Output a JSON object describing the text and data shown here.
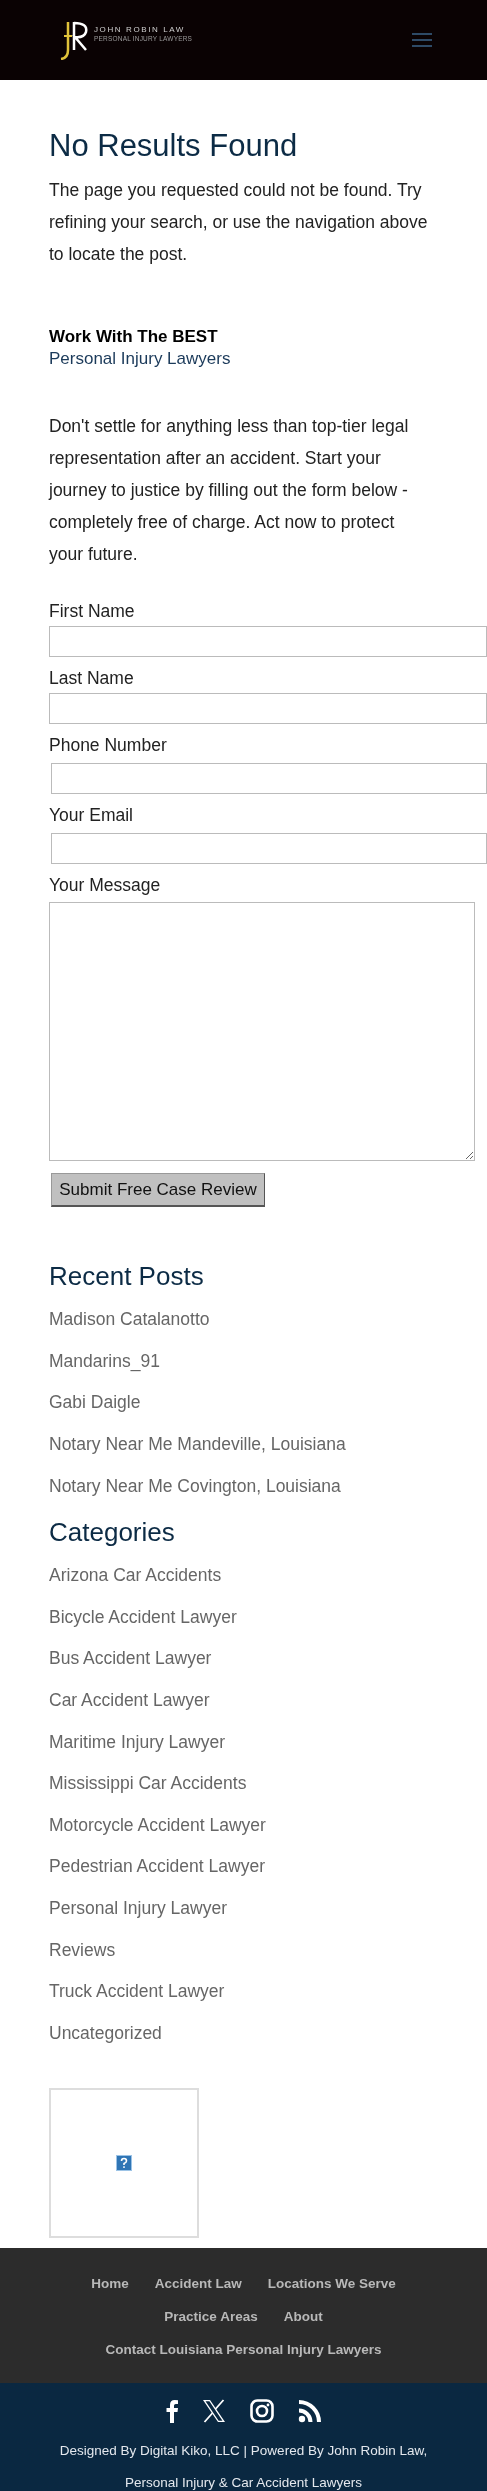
{
  "header": {
    "logo_name": "JOHN ROBIN LAW",
    "logo_tagline": "PERSONAL INJURY LAWYERS"
  },
  "main": {
    "title": "No Results Found",
    "message": "The page you requested could not be found. Try refining your search, or use the navigation above to locate the post."
  },
  "promo": {
    "heading": "Work With The BEST",
    "subheading": "Personal Injury Lawyers",
    "text": "Don't settle for anything less than top-tier legal representation after an accident. Start your journey to justice by filling out the form below - completely free of charge. Act now to protect your future."
  },
  "form": {
    "fields": [
      {
        "label": "First Name",
        "kind": "text"
      },
      {
        "label": "Last Name",
        "kind": "text"
      },
      {
        "label": "Phone Number",
        "kind": "text"
      },
      {
        "label": "Your Email",
        "kind": "text"
      },
      {
        "label": "Your Message",
        "kind": "textarea"
      }
    ],
    "submit": "Submit Free Case Review"
  },
  "recent_posts": {
    "heading": "Recent Posts",
    "items": [
      "Madison Catalanotto",
      "Mandarins_91",
      "Gabi Daigle",
      "Notary Near Me Mandeville, Louisiana",
      "Notary Near Me Covington, Louisiana"
    ]
  },
  "categories": {
    "heading": "Categories",
    "items": [
      "Arizona Car Accidents",
      "Bicycle Accident Lawyer",
      "Bus Accident Lawyer",
      "Car Accident Lawyer",
      "Maritime Injury Lawyer",
      "Mississippi Car Accidents",
      "Motorcycle Accident Lawyer",
      "Pedestrian Accident Lawyer",
      "Personal Injury Lawyer",
      "Reviews",
      "Truck Accident Lawyer",
      "Uncategorized"
    ]
  },
  "footer_nav": {
    "links": [
      "Home",
      "Accident Law",
      "Locations We Serve",
      "Practice Areas",
      "About",
      "Contact Louisiana Personal Injury Lawyers"
    ]
  },
  "footer_bottom": {
    "social": [
      {
        "kind": "facebook"
      },
      {
        "kind": "x"
      },
      {
        "kind": "instagram"
      },
      {
        "kind": "rss"
      }
    ],
    "credits": "Designed By Digital Kiko, LLC | Powered By John Robin Law, Personal Injury & Car Accident Lawyers"
  }
}
